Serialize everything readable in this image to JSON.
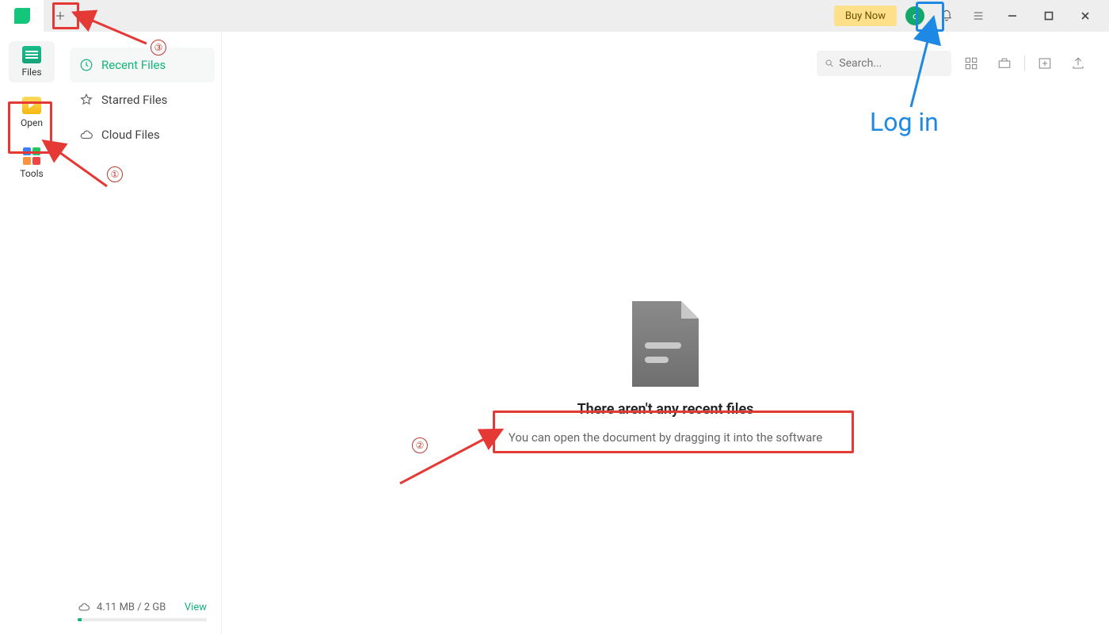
{
  "titlebar": {
    "buy_now": "Buy Now",
    "avatar_letter": "c"
  },
  "rail": {
    "items": [
      {
        "label": "Files"
      },
      {
        "label": "Open"
      },
      {
        "label": "Tools"
      }
    ]
  },
  "sidebar": {
    "items": [
      {
        "label": "Recent Files"
      },
      {
        "label": "Starred Files"
      },
      {
        "label": "Cloud Files"
      }
    ],
    "storage_text": "4.11 MB / 2 GB",
    "view_label": "View"
  },
  "search": {
    "placeholder": "Search..."
  },
  "empty": {
    "title": "There aren't any recent files",
    "subtitle": "You can open the document by dragging it into the software"
  },
  "annotations": {
    "num1": "①",
    "num2": "②",
    "num3": "③",
    "login_label": "Log in"
  },
  "colors": {
    "accent": "#14b47a",
    "buy": "#ffe08a",
    "annotation_red": "#e53935",
    "annotation_blue": "#1e88e5"
  }
}
